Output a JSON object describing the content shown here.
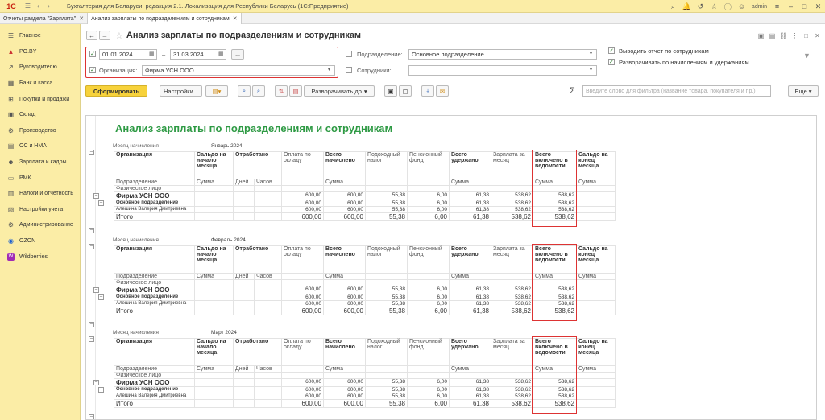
{
  "titlebar": {
    "title": "Бухгалтерия для Беларуси, редакция 2.1. Локализация для Республики Беларусь (1С:Предприятие)",
    "user": "admin"
  },
  "tabs": [
    {
      "label": "Отчеты раздела \"Зарплата\""
    },
    {
      "label": "Анализ зарплаты по подразделениям и сотрудникам"
    }
  ],
  "sidebar": {
    "items": [
      {
        "label": "Главное",
        "icon": "menu-icon"
      },
      {
        "label": "PO.BY",
        "icon": "poby-icon"
      },
      {
        "label": "Руководителю",
        "icon": "chart-icon"
      },
      {
        "label": "Банк и касса",
        "icon": "bank-icon"
      },
      {
        "label": "Покупки и продажи",
        "icon": "cart-icon"
      },
      {
        "label": "Склад",
        "icon": "warehouse-icon"
      },
      {
        "label": "Производство",
        "icon": "factory-icon"
      },
      {
        "label": "ОС и НМА",
        "icon": "assets-icon"
      },
      {
        "label": "Зарплата и кадры",
        "icon": "people-icon"
      },
      {
        "label": "РМК",
        "icon": "pos-icon"
      },
      {
        "label": "Налоги и отчетность",
        "icon": "tax-icon"
      },
      {
        "label": "Настройки учета",
        "icon": "settings-icon"
      },
      {
        "label": "Администрирование",
        "icon": "gear-icon"
      },
      {
        "label": "OZON",
        "icon": "ozon-icon"
      },
      {
        "label": "Wildberries",
        "icon": "wb-icon"
      }
    ]
  },
  "page": {
    "title": "Анализ зарплаты по подразделениям и сотрудникам"
  },
  "filters": {
    "date_from": "01.01.2024",
    "date_to": "31.03.2024",
    "dash": "–",
    "ellipsis": "...",
    "org_label": "Организация:",
    "org_value": "Фирма УСН ООО",
    "dept_label": "Подразделение:",
    "dept_value": "Основное подразделение",
    "emp_label": "Сотрудники:",
    "emp_value": "",
    "opt1": "Выводить отчет по сотрудникам",
    "opt2": "Разворачивать по начислениям и удержаниям"
  },
  "toolbar": {
    "generate": "Сформировать",
    "settings": "Настройки...",
    "expand": "Разворачивать до",
    "search_placeholder": "Введите слово для фильтра (название товара, покупателя и пр.)",
    "more": "Еще"
  },
  "report": {
    "title": "Анализ зарплаты по подразделениям и сотрудникам",
    "month_label": "Месяц начисления",
    "headers": {
      "org": "Организация",
      "sub": "Подразделение",
      "person": "Физическое лицо",
      "saldo_start": "Сальдо на начало месяца",
      "worked": "Отработано",
      "salary": "Оплата по окладу",
      "total_accrued": "Всего начислено",
      "income_tax": "Подоходный налог",
      "pension": "Пенсионный фонд",
      "total_withheld": "Всего удержано",
      "salary_month": "Зарплата за месяц",
      "total_included": "Всего включено в ведомости",
      "saldo_end": "Сальдо на конец месяца",
      "sum": "Сумма",
      "days": "Дней",
      "hours": "Часов"
    },
    "months": [
      {
        "month": "Январь 2024"
      },
      {
        "month": "Февраль 2024"
      },
      {
        "month": "Март 2024"
      }
    ],
    "rows": [
      {
        "name": "Фирма УСН ООО",
        "style": "org",
        "values": [
          "600,00",
          "600,00",
          "55,38",
          "6,00",
          "61,38",
          "538,62",
          "538,62"
        ]
      },
      {
        "name": "Основное подразделение",
        "style": "dept",
        "values": [
          "600,00",
          "600,00",
          "55,38",
          "6,00",
          "61,38",
          "538,62",
          "538,62"
        ]
      },
      {
        "name": "Алешина Валерия Дмитриевна",
        "style": "person",
        "values": [
          "600,00",
          "600,00",
          "55,38",
          "6,00",
          "61,38",
          "538,62",
          "538,62"
        ]
      }
    ],
    "total": {
      "name": "Итого",
      "values": [
        "600,00",
        "600,00",
        "55,38",
        "6,00",
        "61,38",
        "538,62",
        "538,62"
      ]
    }
  }
}
